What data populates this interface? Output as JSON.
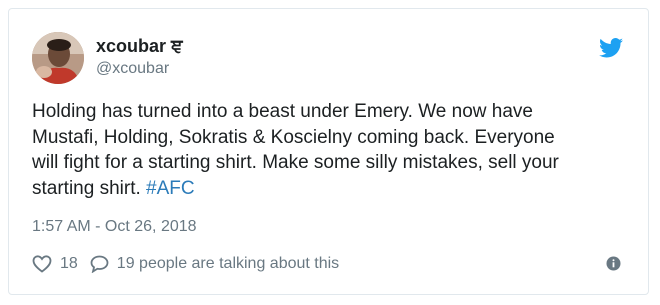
{
  "tweet": {
    "display_name": "xcoubar ਞ",
    "handle": "@xcoubar",
    "text_lines": [
      "Holding has turned into a beast under Emery. We now have",
      "Mustafi, Holding, Sokratis & Koscielny coming back. Everyone",
      "will fight for a starting shirt. Make some silly mistakes, sell your",
      "starting shirt. "
    ],
    "hashtag": "#AFC",
    "timestamp": "1:57 AM - Oct 26, 2018",
    "like_count": "18",
    "talking_text": "19 people are talking about this"
  },
  "icons": {
    "brand": "twitter-bird-icon",
    "like": "heart-icon",
    "reply": "speech-bubble-icon",
    "info": "info-icon"
  },
  "colors": {
    "brand_blue": "#1da1f2",
    "hashtag_blue": "#2b7bb9",
    "secondary_text": "#697882",
    "border": "#e1e8ed"
  }
}
